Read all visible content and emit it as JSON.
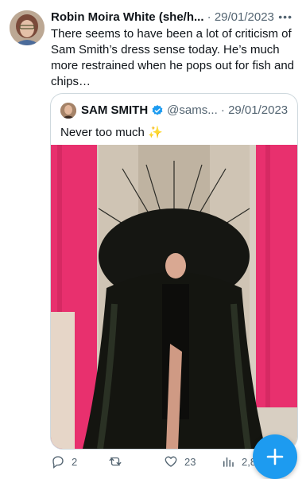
{
  "tweet": {
    "author_name": "Robin Moira White (she/h...",
    "timestamp": " · 29/01/2023",
    "text": "There seems to have been a lot of criticism of Sam Smith’s dress sense today.  He’s much more restrained when he pops out for fish and chips…",
    "more_icon": "more-icon"
  },
  "quoted_tweet": {
    "author_name": "SAM SMITH",
    "handle_time": "@sams... · 29/01/2023",
    "text": "Never too much ",
    "sparkle": "✨",
    "verified_icon": "verified-icon",
    "media": "photo"
  },
  "actions": {
    "reply_count": "2",
    "retweet_count": "",
    "like_count": "23",
    "views_count": "2,8"
  },
  "fab": {
    "icon": "compose-plus-icon"
  },
  "colors": {
    "accent": "#1d9bf0",
    "text": "#0f1419",
    "secondary_text": "#536471",
    "border": "#cfd9de",
    "media_pink": "#e8306e"
  }
}
